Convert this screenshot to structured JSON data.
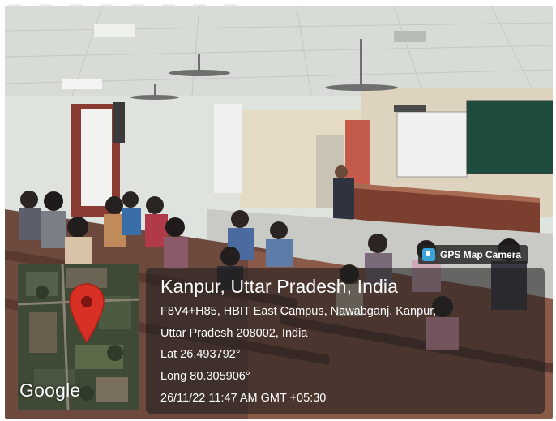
{
  "watermark": {
    "brand_label": "GPS Map Camera",
    "brand_icon": "map-pin-icon",
    "location_title": "Kanpur, Uttar Pradesh, India",
    "address_line1": "F8V4+H85, HBIT East Campus, Nawabganj, Kanpur,",
    "address_line2": "Uttar Pradesh 208002, India",
    "latitude": "Lat 26.493792°",
    "longitude": "Long 80.305906°",
    "datetime": "26/11/22 11:47 AM GMT +05:30",
    "map_provider": "Google",
    "pin_color": "#d93025",
    "panel_color": "#1e1e1e"
  },
  "scene": {
    "board_color": "#1f4d3d",
    "wall_color": "#dfe3de",
    "desk_color": "#7a3f2e"
  }
}
